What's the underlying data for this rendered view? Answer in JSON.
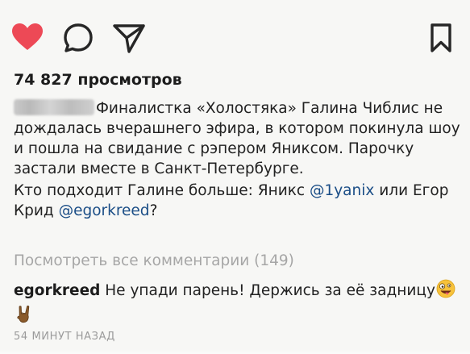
{
  "actions": {
    "like_icon": "heart-icon",
    "comment_icon": "comment-icon",
    "share_icon": "send-icon",
    "save_icon": "bookmark-icon",
    "like_color": "#ed4956"
  },
  "post": {
    "views": "74 827 просмотров",
    "caption_text": "Финалистка «Холостяка» Галина Чиблис не дождалась вчерашнего эфира, в котором покинула шоу и пошла на свидание с рэпером Яниксом. Парочку застали вместе в Санкт-Петербурге.",
    "question_prefix": "Кто подходит Галине больше: Яникс ",
    "mention_1": "@1yanix",
    "question_middle": " или Егор Крид ",
    "mention_2": "@egorkreed",
    "question_suffix": "?",
    "view_all_comments": "Посмотреть все комментарии (149)",
    "timestamp": "54 МИНУТ НАЗАД"
  },
  "comment": {
    "username": "egorkreed",
    "text": " Не упади парень! Держись за её задницу",
    "emoji_1": "zany-face-emoji",
    "emoji_2": "horns-hand-emoji"
  },
  "colors": {
    "mention": "#1a4d86",
    "muted": "#a6a6a6"
  }
}
